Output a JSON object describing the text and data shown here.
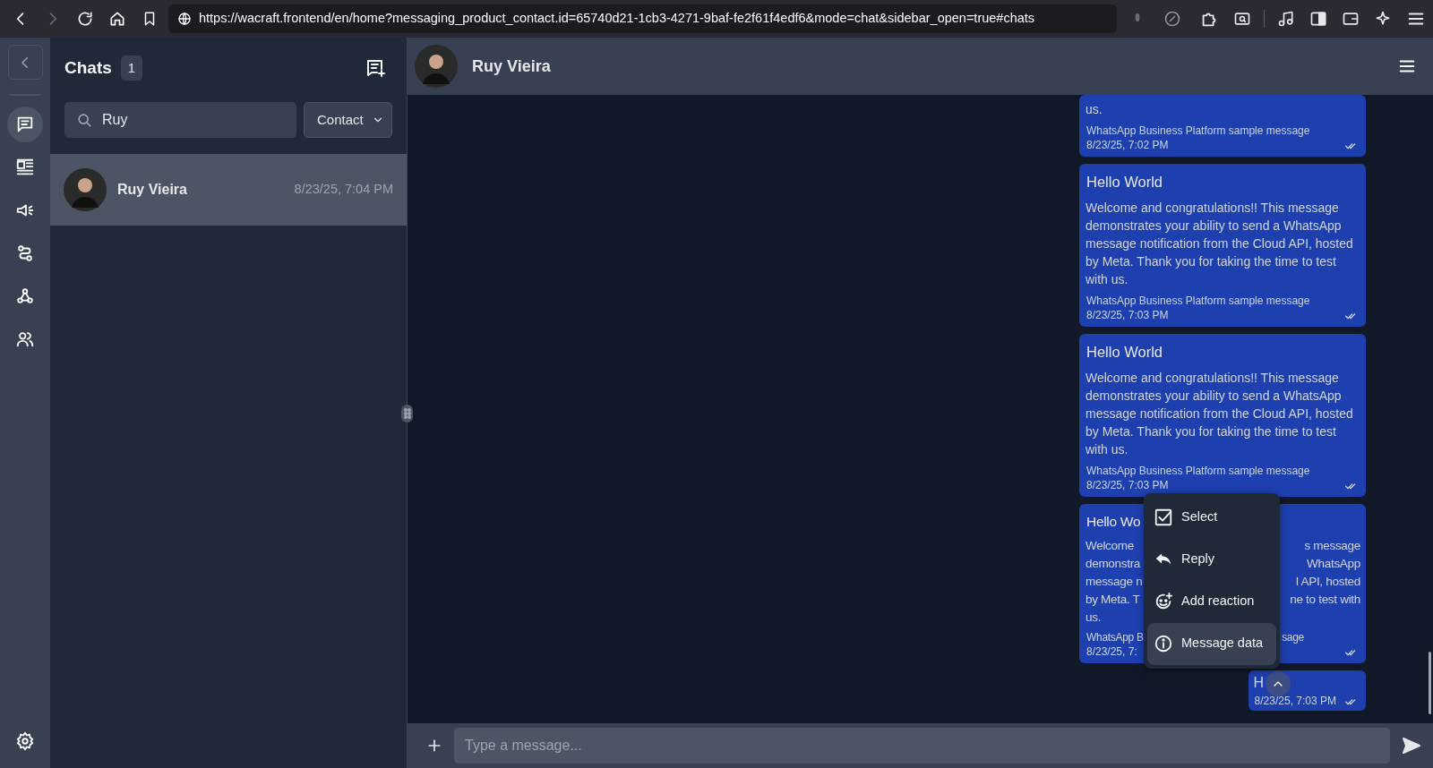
{
  "browser": {
    "url": "https://wacraft.frontend/en/home?messaging_product_contact.id=65740d21-1cb3-4271-9baf-fe2f61f4edf6&mode=chat&sidebar_open=true#chats",
    "forward_disabled": true
  },
  "rail": {
    "items": [
      {
        "selected": true
      },
      {
        "selected": false
      },
      {
        "selected": false
      },
      {
        "selected": false
      },
      {
        "selected": false
      },
      {
        "selected": false
      }
    ]
  },
  "chat_list": {
    "title": "Chats",
    "count": "1",
    "search": {
      "value": "Ruy"
    },
    "filter": {
      "value": "Contact"
    },
    "chats": [
      {
        "name": "Ruy Vieira",
        "time": "8/23/25, 7:04 PM",
        "selected": true
      }
    ]
  },
  "conversation": {
    "contact": "Ruy Vieira",
    "messages": [
      {
        "kind": "template",
        "body": "us.",
        "caption": "WhatsApp Business Platform sample message",
        "time": "8/23/25, 7:02 PM"
      },
      {
        "kind": "template",
        "title": "Hello World",
        "body": "Welcome and congratulations!! This message demonstrates your ability to send a WhatsApp message notification from the Cloud API, hosted by Meta. Thank you for taking the time to test with us.",
        "caption": "WhatsApp Business Platform sample message",
        "time": "8/23/25, 7:03 PM"
      },
      {
        "kind": "template",
        "title": "Hello World",
        "body": "Welcome and congratulations!! This message demonstrates your ability to send a WhatsApp message notification from the Cloud API, hosted by Meta. Thank you for taking the time to test with us.",
        "caption": "WhatsApp Business Platform sample message",
        "time": "8/23/25, 7:03 PM"
      },
      {
        "kind": "covered",
        "title": "Hello Wo",
        "lines": [
          {
            "left": "Welcome",
            "right": "s message"
          },
          {
            "left": "demonstra",
            "right": "WhatsApp"
          },
          {
            "left": "message n",
            "right": "l API, hosted"
          },
          {
            "left": "by Meta. T",
            "right": "ne to test with"
          },
          {
            "left": "us."
          }
        ],
        "caption_left": "WhatsApp B",
        "caption_right": "sage",
        "time": "8/23/25, 7:"
      },
      {
        "kind": "text",
        "body": "H",
        "time": "8/23/25, 7:03 PM"
      }
    ],
    "composer": {
      "placeholder": "Type a message..."
    }
  },
  "context_menu": {
    "items": [
      {
        "label": "Select",
        "selected": false
      },
      {
        "label": "Reply",
        "selected": false
      },
      {
        "label": "Add reaction",
        "selected": false
      },
      {
        "label": "Message data",
        "selected": true
      }
    ]
  }
}
